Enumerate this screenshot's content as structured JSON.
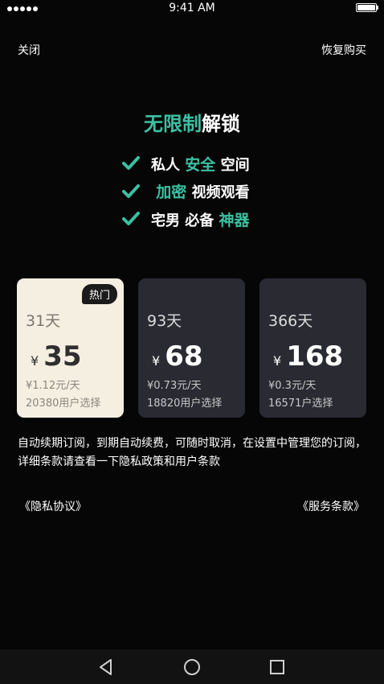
{
  "status_bar": {
    "time": "9:41 AM"
  },
  "header": {
    "close_label": "关闭",
    "restore_label": "恢复购买"
  },
  "headline": {
    "accent": "无限制",
    "rest": "解锁"
  },
  "features": [
    {
      "before": "私人 ",
      "accent": "安全",
      "after": " 空间"
    },
    {
      "before": "",
      "accent": "加密",
      "after": " 视频观看"
    },
    {
      "before": "宅男 必备 ",
      "accent": "神器",
      "after": ""
    }
  ],
  "plans": [
    {
      "badge": "热门",
      "days": "31天",
      "currency": "¥",
      "price": "35",
      "per_day": "¥1.12元/天",
      "users": "20380用户选择"
    },
    {
      "badge": "",
      "days": "93天",
      "currency": "¥",
      "price": "68",
      "per_day": "¥0.73元/天",
      "users": "18820用户选择"
    },
    {
      "badge": "",
      "days": "366天",
      "currency": "¥",
      "price": "168",
      "per_day": "¥0.3元/天",
      "users": "16571户选择"
    }
  ],
  "terms_text": "自动续期订阅，到期自动续费，可随时取消，在设置中管理您的订阅，详细条款请查看一下隐私政策和用户条款",
  "links": {
    "privacy": "《隐私协议》",
    "service": "《服务条款》"
  },
  "colors": {
    "accent": "#3cc0a2",
    "background": "#060606",
    "selected_card": "#f5efe2",
    "card": "#2a2a33"
  },
  "icons": {
    "check": "check-icon",
    "back": "back-triangle-icon",
    "home": "home-circle-icon",
    "recent": "recent-square-icon"
  }
}
